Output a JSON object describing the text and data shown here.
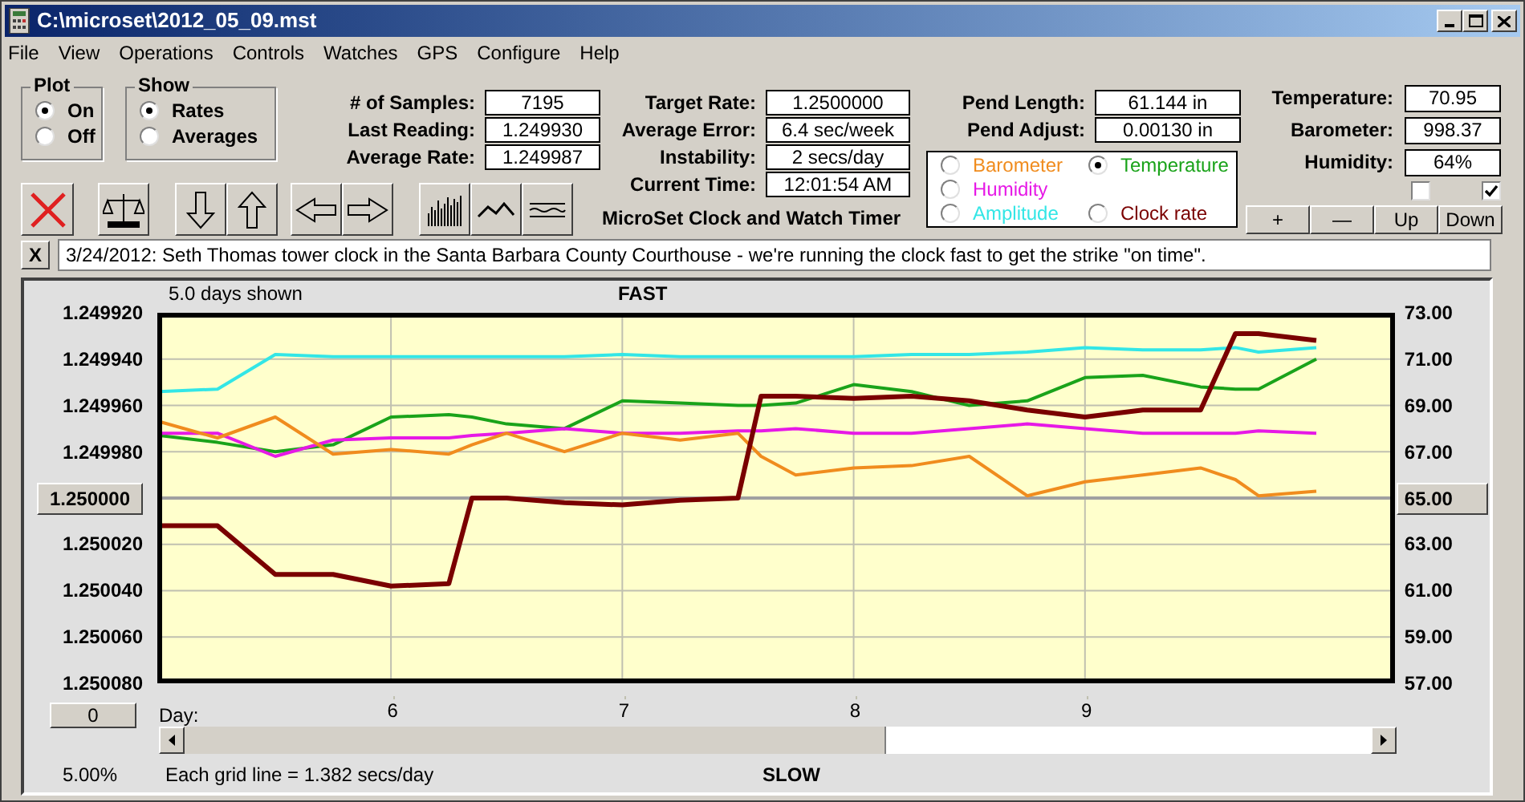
{
  "window": {
    "title": "C:\\microset\\2012_05_09.mst"
  },
  "menu": [
    "File",
    "View",
    "Operations",
    "Controls",
    "Watches",
    "GPS",
    "Configure",
    "Help"
  ],
  "plot_group": {
    "title": "Plot",
    "options": [
      {
        "label": "On",
        "selected": true
      },
      {
        "label": "Off",
        "selected": false
      }
    ]
  },
  "show_group": {
    "title": "Show",
    "options": [
      {
        "label": "Rates",
        "selected": true
      },
      {
        "label": "Averages",
        "selected": false
      }
    ]
  },
  "readouts_1": [
    {
      "label": "# of Samples:",
      "value": "7195"
    },
    {
      "label": "Last Reading:",
      "value": "1.249930"
    },
    {
      "label": "Average Rate:",
      "value": "1.249987"
    }
  ],
  "readouts_2": [
    {
      "label": "Target Rate:",
      "value": "1.2500000"
    },
    {
      "label": "Average Error:",
      "value": "6.4 sec/week"
    },
    {
      "label": "Instability:",
      "value": "2 secs/day"
    },
    {
      "label": "Current Time:",
      "value": "12:01:54 AM"
    }
  ],
  "app_caption": "MicroSet Clock and Watch Timer",
  "readouts_3": [
    {
      "label": "Pend Length:",
      "value": "61.144 in"
    },
    {
      "label": "Pend Adjust:",
      "value": "0.00130 in"
    }
  ],
  "sensor_select": [
    {
      "label": "Barometer",
      "color": "#f08c1e",
      "selected": false
    },
    {
      "label": "Temperature",
      "color": "#1aa31a",
      "selected": true
    },
    {
      "label": "Humidity",
      "color": "#e619e6",
      "selected": false
    },
    {
      "label": "Amplitude",
      "color": "#33e6e6",
      "selected": false
    },
    {
      "label": "Clock rate",
      "color": "#7a0000",
      "selected": false
    }
  ],
  "readouts_4": [
    {
      "label": "Temperature:",
      "value": "70.95"
    },
    {
      "label": "Barometer:",
      "value": "998.37"
    },
    {
      "label": "Humidity:",
      "value": "64%"
    }
  ],
  "checkboxes": [
    {
      "checked": false
    },
    {
      "checked": true
    }
  ],
  "scale_buttons": [
    "+",
    "—",
    "Up",
    "Down"
  ],
  "note": {
    "close_label": "X",
    "text": "3/24/2012: Seth Thomas tower clock in the Santa Barbara County Courthouse - we're running the clock fast to get the strike \"on time\"."
  },
  "chart": {
    "days_shown": "5.0 days shown",
    "top_label": "FAST",
    "bottom_label": "SLOW",
    "offset_button": "0",
    "percent": "5.00%",
    "grid_note": "Each grid line = 1.382 secs/day",
    "left_axis": [
      {
        "label": "1.249920",
        "kind": "text"
      },
      {
        "label": "1.249940",
        "kind": "text"
      },
      {
        "label": "1.249960",
        "kind": "text"
      },
      {
        "label": "1.249980",
        "kind": "text"
      },
      {
        "label": "1.250000",
        "kind": "button"
      },
      {
        "label": "1.250020",
        "kind": "text"
      },
      {
        "label": "1.250040",
        "kind": "text"
      },
      {
        "label": "1.250060",
        "kind": "text"
      },
      {
        "label": "1.250080",
        "kind": "text"
      }
    ],
    "chart_data": {
      "type": "line",
      "grid": true,
      "ref_lines": [
        {
          "axis": "y",
          "value": 65
        }
      ],
      "xlabel": "Day:",
      "xlim": [
        4.99,
        10.34
      ],
      "ylim": [
        57,
        73
      ],
      "xticks": [
        {
          "value": 6,
          "label": "6"
        },
        {
          "value": 7,
          "label": "7"
        },
        {
          "value": 8,
          "label": "8"
        },
        {
          "value": 9,
          "label": "9"
        }
      ],
      "yticks": [
        {
          "value": 57,
          "label": "57.00"
        },
        {
          "value": 59,
          "label": "59.00"
        },
        {
          "value": 61,
          "label": "61.00"
        },
        {
          "value": 63,
          "label": "63.00"
        },
        {
          "value": 65,
          "label": "65.00"
        },
        {
          "value": 67,
          "label": "67.00"
        },
        {
          "value": 69,
          "label": "69.00"
        },
        {
          "value": 71,
          "label": "71.00"
        },
        {
          "value": 73,
          "label": "73.00"
        }
      ],
      "x": [
        5,
        5.25,
        5.5,
        5.75,
        6,
        6.25,
        6.35,
        6.5,
        6.75,
        7,
        7.25,
        7.5,
        7.6,
        7.75,
        8,
        8.25,
        8.5,
        8.75,
        9,
        9.25,
        9.5,
        9.65,
        9.75,
        10
      ],
      "series": [
        {
          "color": "#33e6e6",
          "values": [
            69.6,
            69.7,
            71.2,
            71.1,
            71.1,
            71.1,
            71.1,
            71.1,
            71.1,
            71.2,
            71.1,
            71.1,
            71.1,
            71.1,
            71.1,
            71.2,
            71.2,
            71.3,
            71.5,
            71.4,
            71.4,
            71.5,
            71.3,
            71.5
          ]
        },
        {
          "color": "#1aa31a",
          "values": [
            67.7,
            67.4,
            67.0,
            67.3,
            68.5,
            68.6,
            68.5,
            68.2,
            68.0,
            69.2,
            69.1,
            69.0,
            69.0,
            69.1,
            69.9,
            69.6,
            69.0,
            69.2,
            70.2,
            70.3,
            69.8,
            69.7,
            69.7,
            71.0
          ]
        },
        {
          "color": "#e619e6",
          "values": [
            67.8,
            67.8,
            66.8,
            67.5,
            67.6,
            67.6,
            67.7,
            67.8,
            68.0,
            67.8,
            67.8,
            67.9,
            67.9,
            68.0,
            67.8,
            67.8,
            68.0,
            68.2,
            68.0,
            67.8,
            67.8,
            67.8,
            67.9,
            67.8
          ]
        },
        {
          "color": "#f08c1e",
          "values": [
            68.3,
            67.6,
            68.5,
            66.9,
            67.1,
            66.9,
            67.3,
            67.8,
            67.0,
            67.8,
            67.5,
            67.8,
            66.8,
            66.0,
            66.3,
            66.4,
            66.8,
            65.1,
            65.7,
            66.0,
            66.3,
            65.8,
            65.1,
            65.3
          ]
        },
        {
          "color": "#7a0000",
          "values": [
            63.8,
            63.8,
            61.7,
            61.7,
            61.2,
            61.3,
            65.0,
            65.0,
            64.8,
            64.7,
            64.9,
            65.0,
            69.4,
            69.4,
            69.3,
            69.4,
            69.2,
            68.8,
            68.5,
            68.8,
            68.8,
            72.1,
            72.1,
            71.8
          ]
        }
      ]
    }
  }
}
